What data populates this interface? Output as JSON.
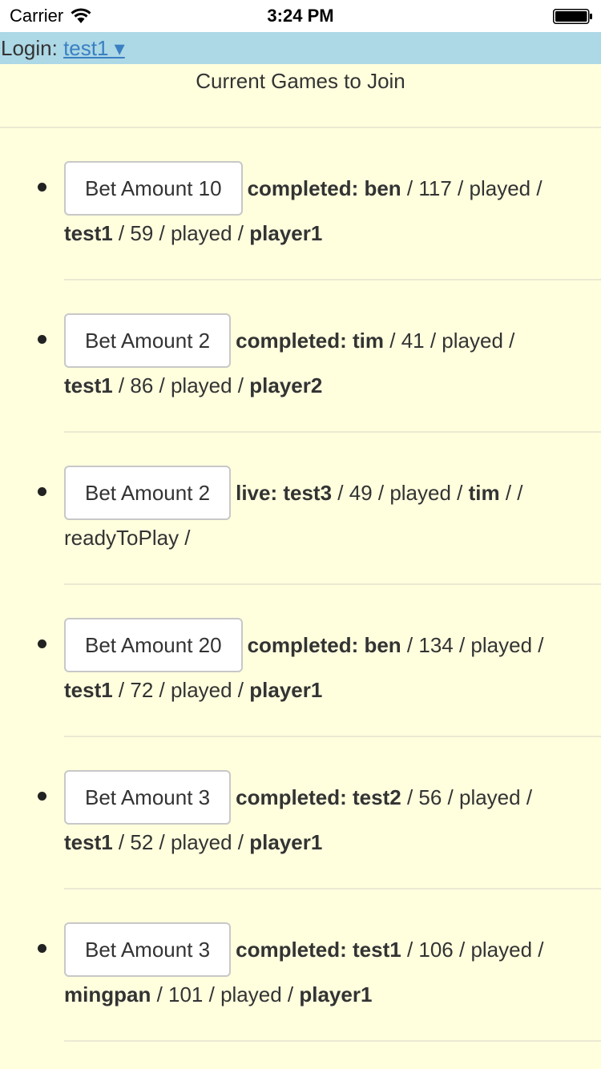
{
  "status_bar": {
    "carrier": "Carrier",
    "time": "3:24 PM",
    "icons": [
      "wifi-icon",
      "battery-icon"
    ]
  },
  "login": {
    "label": "Login:",
    "user": "test1 ▾"
  },
  "title": "Current Games to Join",
  "colors": {
    "background": "#ffffde",
    "login_bar": "#add8e6",
    "link": "#3a80c2"
  },
  "games": [
    {
      "bet": "Bet Amount 10",
      "status": "completed: ben",
      "l1_rest": " / 117 / played /",
      "l2_bold1": "test1",
      "l2_mid": " / 59 / played / ",
      "l2_bold2": "player1"
    },
    {
      "bet": "Bet Amount 2",
      "status": "completed: tim",
      "l1_rest": " / 41 / played /",
      "l2_bold1": "test1",
      "l2_mid": " / 86 / played / ",
      "l2_bold2": "player2"
    },
    {
      "bet": "Bet Amount 2",
      "status": "live: test3",
      "l1_rest": " / 49 / played / ",
      "l1_bold2": "tim",
      "l1_tail": " / /",
      "l2_bold1": "",
      "l2_mid": "readyToPlay /",
      "l2_bold2": ""
    },
    {
      "bet": "Bet Amount 20",
      "status": "completed: ben",
      "l1_rest": " / 134 / played /",
      "l2_bold1": "test1",
      "l2_mid": " / 72 / played / ",
      "l2_bold2": "player1"
    },
    {
      "bet": "Bet Amount 3",
      "status": "completed: test2",
      "l1_rest": " / 56 / played /",
      "l2_bold1": "test1",
      "l2_mid": " / 52 / played / ",
      "l2_bold2": "player1"
    },
    {
      "bet": "Bet Amount 3",
      "status": "completed: test1",
      "l1_rest": " / 106 / played /",
      "l2_bold1": "mingpan",
      "l2_mid": " / 101 / played / ",
      "l2_bold2": "player1"
    }
  ]
}
